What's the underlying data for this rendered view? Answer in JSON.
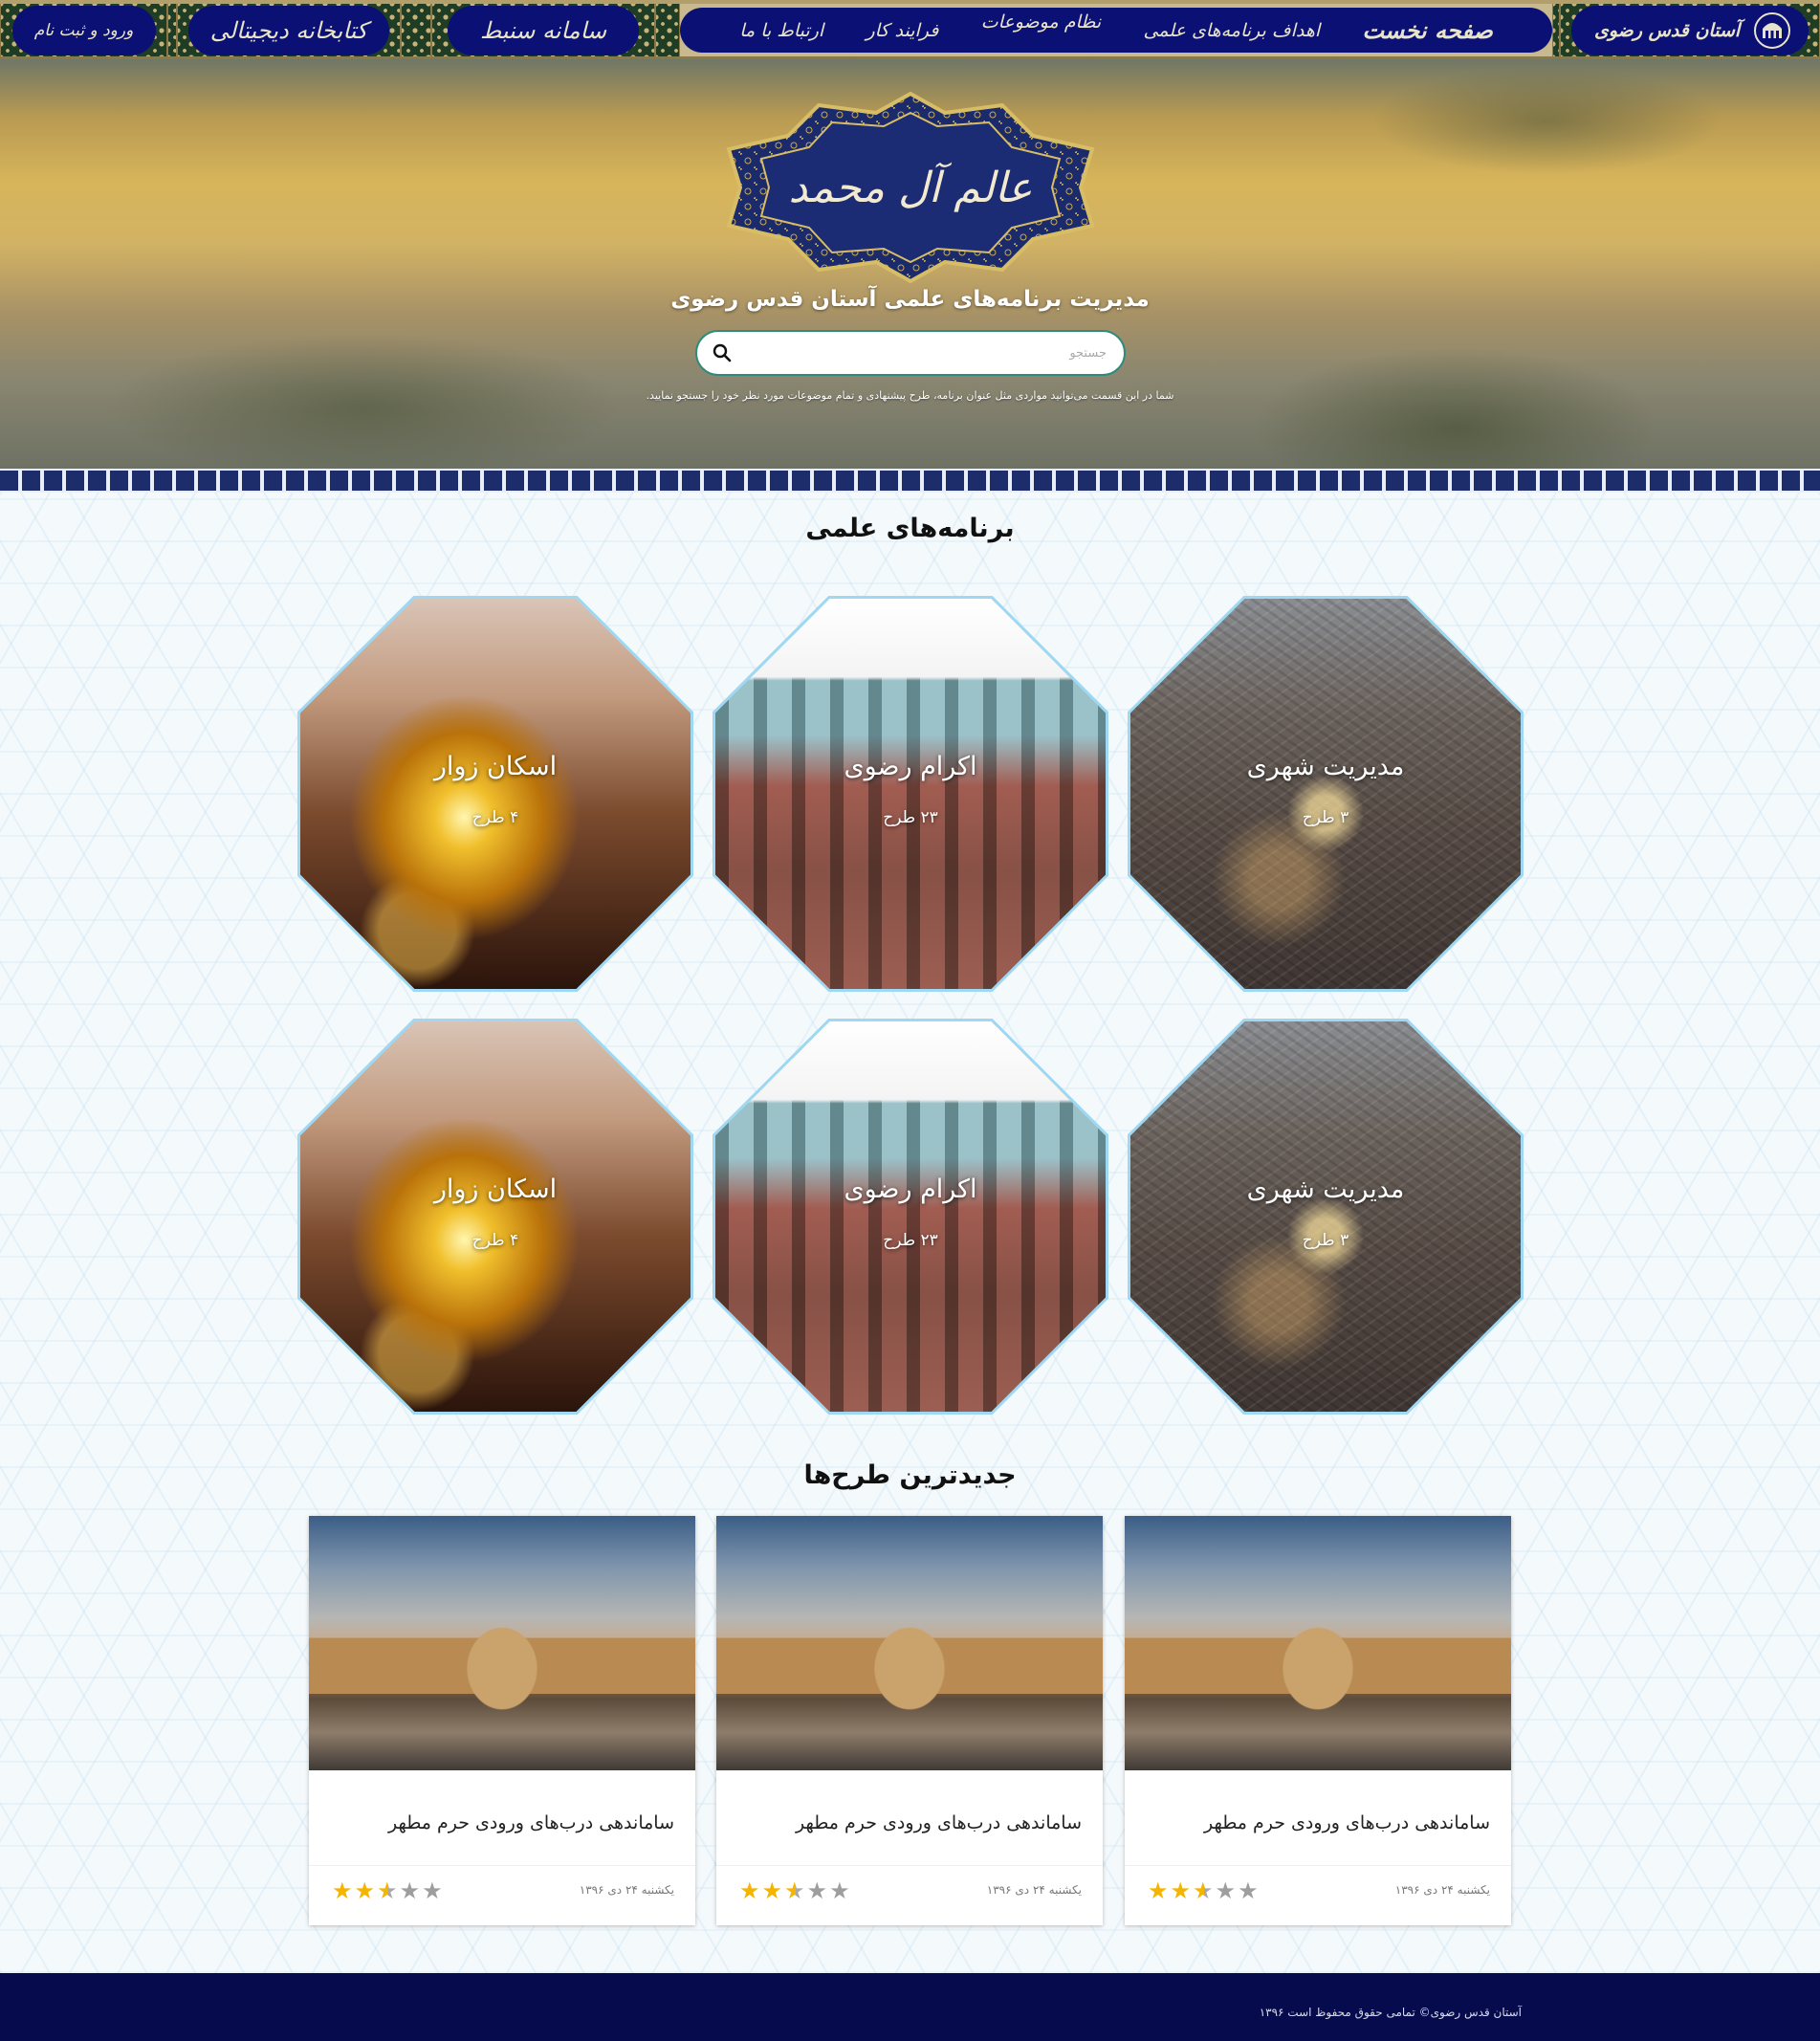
{
  "nav": {
    "logo_text": "آستان قدس رضوی",
    "main_items": [
      {
        "label": "صفحه نخست"
      },
      {
        "label": "اهداف برنامه‌های علمی"
      },
      {
        "label": "نظام موضوعات"
      },
      {
        "label": "فرایند کار"
      },
      {
        "label": "ارتباط با ما"
      }
    ],
    "samaneh_label": "سامانه سنبط",
    "library_label": "کتابخانه دیجیتالی",
    "login_label": "ورود و ثبت نام"
  },
  "hero": {
    "emblem_text": "عالم آل محمد",
    "title": "مدیریت برنامه‌های علمی آستان قدس رضوی",
    "search_placeholder": "جستجو",
    "search_hint": "شما در این قسمت می‌توانید مواردی مثل عنوان برنامه، طرح پیشنهادی و تمام موضوعات مورد نظر خود را جستجو نمایید."
  },
  "programs": {
    "heading": "برنامه‌های علمی",
    "items": [
      {
        "title": "مدیریت شهری",
        "count": "۳ طرح",
        "image": "city-aerial"
      },
      {
        "title": "اکرام رضوی",
        "count": "۲۳ طرح",
        "image": "courtyard"
      },
      {
        "title": "اسکان زوار",
        "count": "۴ طرح",
        "image": "golden-dome"
      },
      {
        "title": "مدیریت شهری",
        "count": "۳ طرح",
        "image": "city-aerial"
      },
      {
        "title": "اکرام رضوی",
        "count": "۲۳ طرح",
        "image": "courtyard"
      },
      {
        "title": "اسکان زوار",
        "count": "۴ طرح",
        "image": "golden-dome"
      }
    ]
  },
  "latest": {
    "heading": "جدیدترین طرح‌ها",
    "cards": [
      {
        "title": "ساماندهی درب‌های ورودی حرم مطهر",
        "date": "یکشنبه ۲۴ دی ۱۳۹۶",
        "rating": 2.5
      },
      {
        "title": "ساماندهی درب‌های ورودی حرم مطهر",
        "date": "یکشنبه ۲۴ دی ۱۳۹۶",
        "rating": 2.5
      },
      {
        "title": "ساماندهی درب‌های ورودی حرم مطهر",
        "date": "یکشنبه ۲۴ دی ۱۳۹۶",
        "rating": 2.5
      }
    ]
  },
  "footer": {
    "copyright": "آستان قدس رضوی© تمامی حقوق محفوظ است ۱۳۹۶"
  },
  "colors": {
    "nav_blue": "#0b1075",
    "footer_navy": "#050b4d",
    "star_gold": "#f4b400",
    "search_border": "#2e8b7c"
  }
}
